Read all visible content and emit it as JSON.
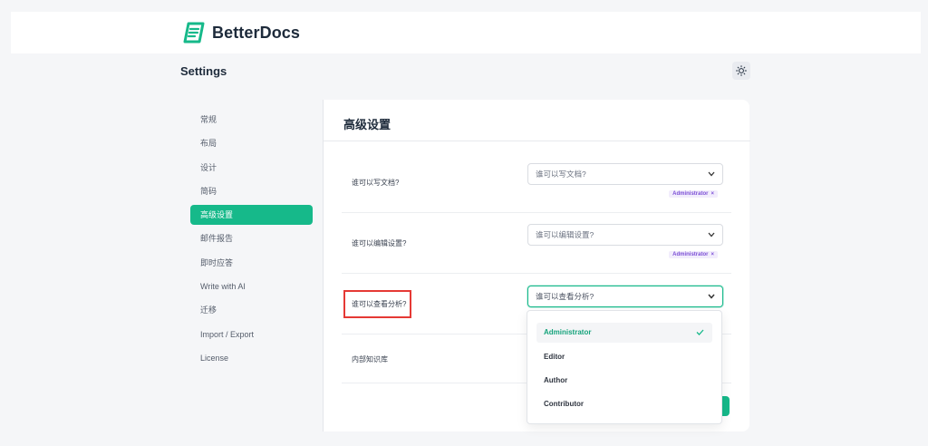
{
  "app": {
    "name": "BetterDocs",
    "brand_color": "#16b98a",
    "logo_icon": "betterdocs-logo-icon"
  },
  "page": {
    "title": "Settings",
    "theme_toggle_icon": "sun-icon"
  },
  "sidebar": {
    "items": [
      {
        "label": "常规"
      },
      {
        "label": "布局"
      },
      {
        "label": "设计"
      },
      {
        "label": "简码"
      },
      {
        "label": "高级设置",
        "active": true
      },
      {
        "label": "邮件报告"
      },
      {
        "label": "即时应答"
      },
      {
        "label": "Write with AI"
      },
      {
        "label": "迁移"
      },
      {
        "label": "Import / Export"
      },
      {
        "label": "License"
      }
    ]
  },
  "panel": {
    "title": "高级设置",
    "rows": [
      {
        "label": "谁可以写文档?",
        "placeholder": "谁可以写文档?",
        "tag": "Administrator"
      },
      {
        "label": "谁可以编辑设置?",
        "placeholder": "谁可以编辑设置?",
        "tag": "Administrator"
      },
      {
        "label": "谁可以查看分析?",
        "placeholder": "谁可以查看分析?"
      },
      {
        "label": "内部知识库"
      }
    ]
  },
  "dropdown": {
    "options": [
      {
        "label": "Administrator",
        "selected": true
      },
      {
        "label": "Editor"
      },
      {
        "label": "Author"
      },
      {
        "label": "Contributor"
      }
    ]
  },
  "colors": {
    "highlight_box": "#e53935",
    "tag_text": "#7c4fd6"
  }
}
